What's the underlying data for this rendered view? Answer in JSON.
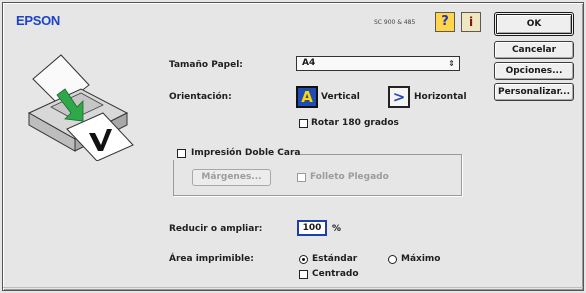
{
  "header": {
    "brand": "EPSON",
    "model": "SC 900 & 485"
  },
  "toolbar": {
    "help_glyph": "?",
    "info_glyph": "i"
  },
  "buttons": {
    "ok": "OK",
    "cancel": "Cancelar",
    "options": "Opciones...",
    "customize": "Personalizar..."
  },
  "paper": {
    "label": "Tamaño Papel:",
    "value": "A4"
  },
  "orientation": {
    "label": "Orientación:",
    "vertical": "Vertical",
    "horizontal": "Horizontal",
    "rotate": "Rotar 180 grados",
    "selected": "vertical"
  },
  "duplex": {
    "label": "Impresión Doble Cara",
    "margins_button": "Márgenes...",
    "folded": "Folleto Plegado"
  },
  "zoom": {
    "label": "Reducir o ampliar:",
    "value": "100",
    "unit": "%"
  },
  "area": {
    "label": "Área imprimible:",
    "standard": "Estándar",
    "maximum": "Máximo",
    "centered": "Centrado",
    "selected": "standard"
  },
  "colors": {
    "brand": "#1c43c9",
    "accent": "#1c3fa8",
    "arrow": "#2fa84a"
  },
  "icons": {
    "printer": "printer-illustration-icon",
    "help": "help-balloon-icon",
    "info": "printer-info-icon",
    "vertical": "portrait-orientation-icon",
    "horizontal": "landscape-orientation-icon"
  }
}
